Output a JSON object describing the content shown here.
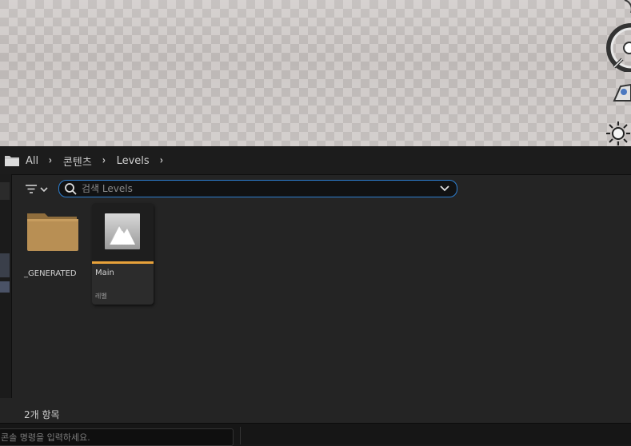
{
  "breadcrumb": {
    "items": [
      "All",
      "콘텐츠",
      "Levels"
    ],
    "separator": "›"
  },
  "search": {
    "placeholder": "검색 Levels",
    "value": ""
  },
  "assets": {
    "folder": {
      "name": "_GENERATED",
      "icon": "folder-icon"
    },
    "level": {
      "name": "Main",
      "type": "레벨",
      "icon": "level-thumbnail-icon",
      "accent": "#e8a23a"
    }
  },
  "status": {
    "item_count": "2개 항목",
    "console_placeholder": "콘솔 명령을 입력하세요."
  },
  "colors": {
    "search_border": "#2d7fd1",
    "panel_bg": "#242424"
  }
}
